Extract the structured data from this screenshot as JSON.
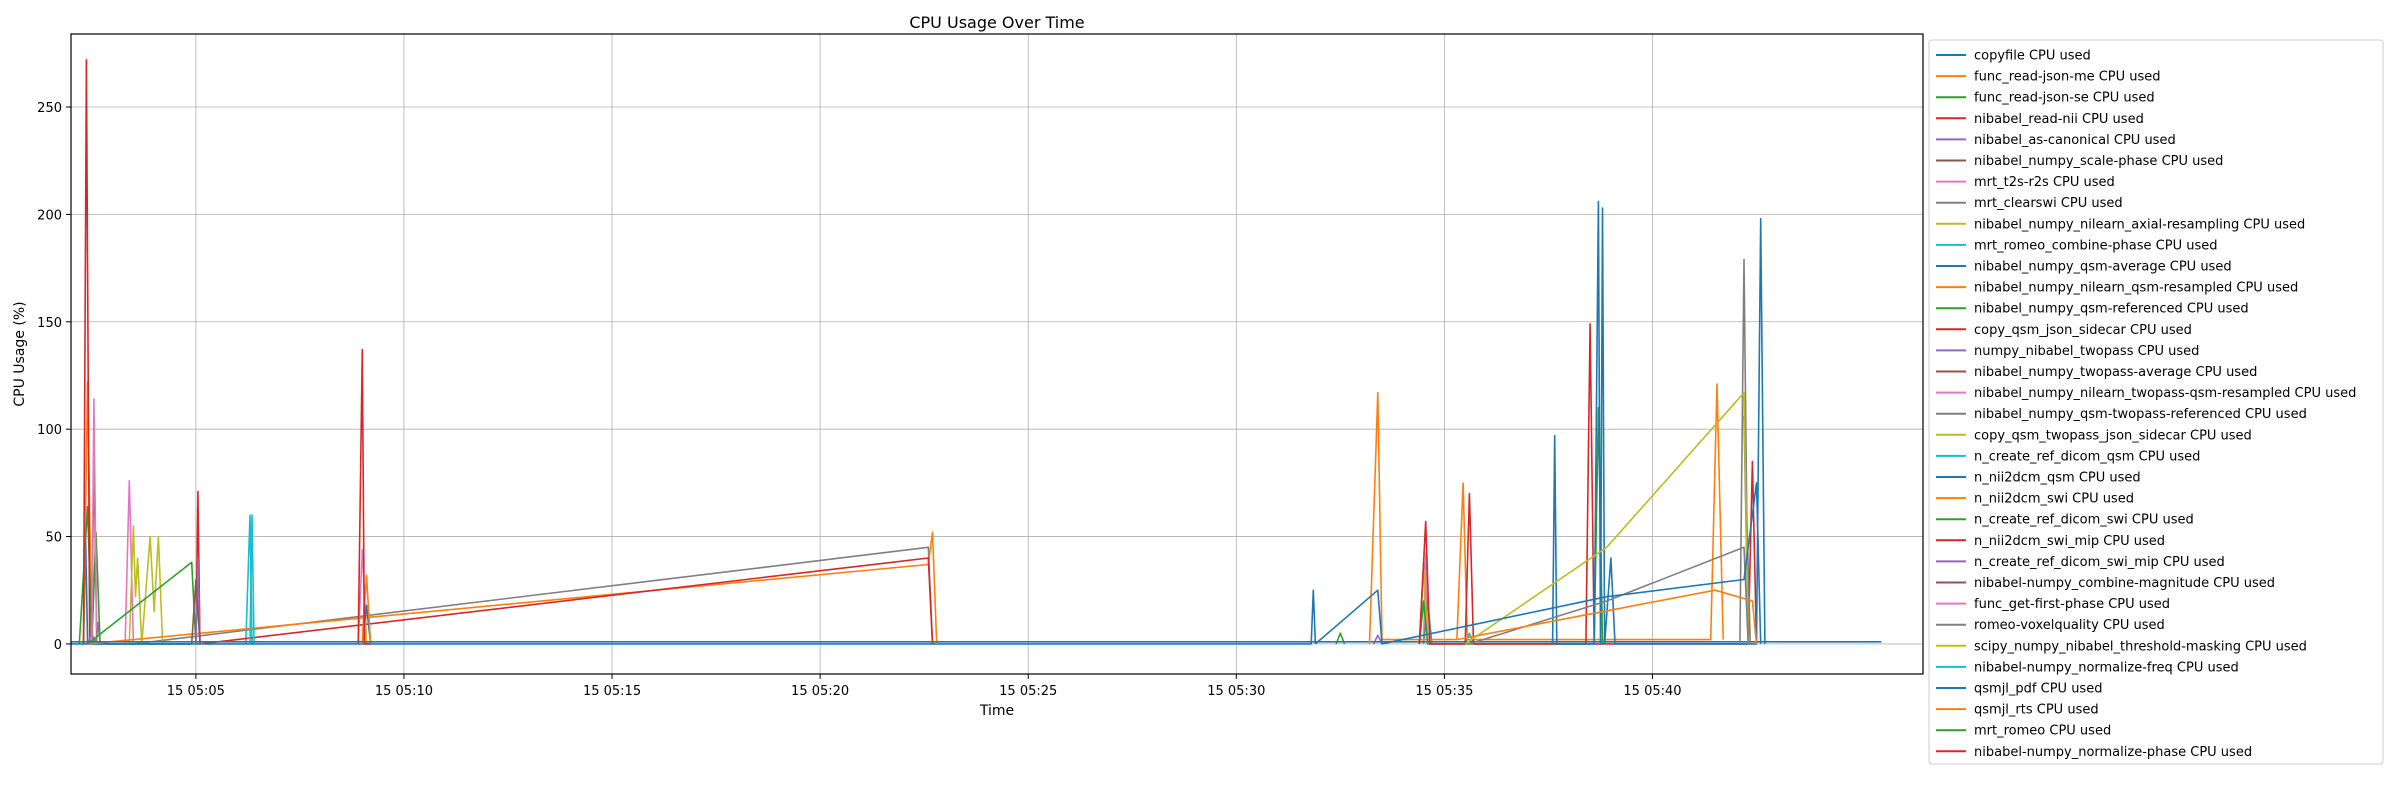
{
  "chart_data": {
    "type": "line",
    "title": "CPU Usage Over Time",
    "xlabel": "Time",
    "ylabel": "CPU Usage (%)",
    "x_ticks": [
      "15 05:05",
      "15 05:10",
      "15 05:15",
      "15 05:20",
      "15 05:25",
      "15 05:30",
      "15 05:35",
      "15 05:40"
    ],
    "x_tick_values_min": [
      65,
      70,
      75,
      80,
      85,
      90,
      95,
      100
    ],
    "xlim_min": [
      62.0,
      106.5
    ],
    "y_ticks": [
      0,
      50,
      100,
      150,
      200,
      250
    ],
    "ylim": [
      -14,
      284
    ],
    "grid": true,
    "legend_position": "outside right",
    "colors": [
      "#1f77b4",
      "#ff7f0e",
      "#2ca02c",
      "#d62728",
      "#9467bd",
      "#8c564b",
      "#e377c2",
      "#7f7f7f",
      "#bcbd22",
      "#17becf"
    ],
    "series": [
      {
        "name": "copyfile CPU used",
        "points": [
          [
            62.3,
            0
          ],
          [
            62.35,
            50
          ],
          [
            62.4,
            0
          ],
          [
            64.9,
            0
          ]
        ]
      },
      {
        "name": "func_read-json-me CPU used",
        "points": [
          [
            62.3,
            0
          ],
          [
            62.4,
            122
          ],
          [
            62.5,
            0
          ],
          [
            62.9,
            0
          ]
        ]
      },
      {
        "name": "func_read-json-se CPU used",
        "points": [
          [
            62.2,
            0
          ],
          [
            62.4,
            64
          ],
          [
            62.5,
            0
          ],
          [
            62.6,
            52
          ],
          [
            62.7,
            0
          ],
          [
            64.9,
            0
          ]
        ]
      },
      {
        "name": "nibabel_read-nii CPU used",
        "points": [
          [
            62.3,
            0
          ],
          [
            62.37,
            272
          ],
          [
            62.45,
            0
          ],
          [
            62.6,
            2
          ]
        ]
      },
      {
        "name": "nibabel_as-canonical CPU used",
        "points": [
          [
            62.4,
            0
          ],
          [
            62.5,
            5
          ],
          [
            62.6,
            0
          ]
        ]
      },
      {
        "name": "nibabel_numpy_scale-phase CPU used",
        "points": [
          [
            62.5,
            0
          ],
          [
            62.55,
            90
          ],
          [
            62.62,
            0
          ],
          [
            62.7,
            0
          ]
        ]
      },
      {
        "name": "mrt_t2s-r2s CPU used",
        "points": [
          [
            62.5,
            0
          ],
          [
            62.55,
            114
          ],
          [
            62.62,
            0
          ],
          [
            63.3,
            0
          ],
          [
            63.4,
            76
          ],
          [
            63.5,
            0
          ]
        ]
      },
      {
        "name": "mrt_clearswi CPU used",
        "points": [
          [
            62.6,
            0
          ],
          [
            62.65,
            10
          ],
          [
            62.7,
            0
          ],
          [
            63.5,
            0
          ],
          [
            82.6,
            45
          ],
          [
            82.7,
            0
          ]
        ]
      },
      {
        "name": "nibabel_numpy_nilearn_axial-resampling CPU used",
        "points": [
          [
            63.4,
            0
          ],
          [
            63.5,
            55
          ],
          [
            63.55,
            22
          ],
          [
            63.6,
            40
          ],
          [
            63.7,
            0
          ],
          [
            63.9,
            50
          ],
          [
            64.0,
            15
          ],
          [
            64.1,
            50
          ],
          [
            64.2,
            0
          ]
        ]
      },
      {
        "name": "mrt_romeo_combine-phase CPU used",
        "points": [
          [
            66.2,
            0
          ],
          [
            66.3,
            60
          ],
          [
            66.35,
            0
          ],
          [
            66.4,
            0
          ]
        ]
      },
      {
        "name": "nibabel_numpy_qsm-average CPU used",
        "points": [
          [
            62.0,
            0
          ],
          [
            91.8,
            0
          ],
          [
            91.85,
            25
          ],
          [
            91.9,
            0
          ]
        ]
      },
      {
        "name": "nibabel_numpy_nilearn_qsm-resampled CPU used",
        "points": [
          [
            62.4,
            0
          ],
          [
            82.6,
            37
          ],
          [
            82.7,
            52
          ],
          [
            82.8,
            0
          ]
        ]
      },
      {
        "name": "nibabel_numpy_qsm-referenced CPU used",
        "points": [
          [
            62.4,
            0
          ],
          [
            64.9,
            38
          ],
          [
            65.0,
            0
          ],
          [
            65.1,
            0
          ]
        ]
      },
      {
        "name": "copy_qsm_json_sidecar CPU used",
        "points": [
          [
            65.0,
            0
          ],
          [
            65.05,
            71
          ],
          [
            65.1,
            0
          ],
          [
            82.6,
            40
          ],
          [
            82.7,
            0
          ]
        ]
      },
      {
        "name": "numpy_nibabel_twopass CPU used",
        "points": [
          [
            65.0,
            0
          ],
          [
            65.05,
            40
          ],
          [
            65.1,
            0
          ],
          [
            65.2,
            0
          ]
        ]
      },
      {
        "name": "nibabel_numpy_twopass-average CPU used",
        "points": [
          [
            64.9,
            0
          ],
          [
            65.0,
            30
          ],
          [
            65.1,
            0
          ]
        ]
      },
      {
        "name": "nibabel_numpy_nilearn_twopass-qsm-resampled CPU used",
        "points": [
          [
            68.9,
            0
          ],
          [
            69.0,
            44
          ],
          [
            69.1,
            0
          ]
        ]
      },
      {
        "name": "nibabel_numpy_qsm-twopass-referenced CPU used",
        "points": [
          [
            69.0,
            0
          ],
          [
            69.05,
            20
          ],
          [
            69.1,
            0
          ]
        ]
      },
      {
        "name": "copy_qsm_twopass_json_sidecar CPU used",
        "points": [
          [
            69.0,
            0
          ],
          [
            69.05,
            18
          ],
          [
            69.1,
            0
          ]
        ]
      },
      {
        "name": "n_create_ref_dicom_qsm CPU used",
        "points": [
          [
            66.3,
            0
          ],
          [
            66.35,
            60
          ],
          [
            66.4,
            0
          ]
        ]
      },
      {
        "name": "n_nii2dcm_qsm CPU used",
        "points": [
          [
            69.0,
            0
          ],
          [
            69.1,
            18
          ],
          [
            69.2,
            0
          ]
        ]
      },
      {
        "name": "n_nii2dcm_swi CPU used",
        "points": [
          [
            69.0,
            0
          ],
          [
            69.1,
            32
          ],
          [
            69.2,
            0
          ]
        ]
      },
      {
        "name": "n_create_ref_dicom_swi CPU used",
        "points": [
          [
            92.4,
            0
          ],
          [
            92.5,
            5
          ],
          [
            92.6,
            0
          ]
        ]
      },
      {
        "name": "n_nii2dcm_swi_mip CPU used",
        "points": [
          [
            68.9,
            0
          ],
          [
            69.0,
            137
          ],
          [
            69.05,
            0
          ],
          [
            69.2,
            0
          ]
        ]
      },
      {
        "name": "n_create_ref_dicom_swi_mip CPU used",
        "points": [
          [
            93.3,
            0
          ],
          [
            93.4,
            4
          ],
          [
            93.5,
            0
          ]
        ]
      },
      {
        "name": "nibabel-numpy_combine-magnitude CPU used",
        "points": [
          [
            94.4,
            0
          ],
          [
            94.5,
            38
          ],
          [
            94.6,
            0
          ]
        ]
      },
      {
        "name": "func_get-first-phase CPU used",
        "points": [
          [
            94.5,
            0
          ],
          [
            94.55,
            42
          ],
          [
            94.6,
            0
          ]
        ]
      },
      {
        "name": "romeo-voxelquality CPU used",
        "points": [
          [
            94.5,
            0
          ],
          [
            94.6,
            20
          ],
          [
            94.7,
            0
          ]
        ]
      },
      {
        "name": "scipy_numpy_nibabel_threshold-masking CPU used",
        "points": [
          [
            94.4,
            0
          ],
          [
            94.5,
            35
          ],
          [
            94.6,
            0
          ]
        ]
      },
      {
        "name": "nibabel-numpy_normalize-freq CPU used",
        "points": [
          [
            95.5,
            0
          ],
          [
            95.6,
            5
          ],
          [
            95.7,
            0
          ]
        ]
      },
      {
        "name": "qsmjl_pdf CPU used",
        "points": [
          [
            62.0,
            1
          ],
          [
            105.5,
            1
          ]
        ]
      },
      {
        "name": "qsmjl_rts CPU used",
        "points": [
          [
            93.2,
            0
          ],
          [
            93.4,
            117
          ],
          [
            93.5,
            2
          ],
          [
            95.3,
            2
          ],
          [
            95.45,
            75
          ],
          [
            95.55,
            2
          ],
          [
            101.4,
            2
          ],
          [
            101.55,
            121
          ],
          [
            101.7,
            2
          ]
        ]
      },
      {
        "name": "mrt_romeo CPU used",
        "points": [
          [
            94.4,
            0
          ],
          [
            94.5,
            20
          ],
          [
            94.6,
            0
          ],
          [
            98.6,
            0
          ],
          [
            98.7,
            110
          ],
          [
            98.8,
            0
          ]
        ]
      },
      {
        "name": "nibabel-numpy_normalize-phase CPU used",
        "points": [
          [
            94.4,
            0
          ],
          [
            94.55,
            57
          ],
          [
            94.65,
            0
          ],
          [
            95.5,
            0
          ],
          [
            95.6,
            70
          ],
          [
            95.7,
            0
          ],
          [
            98.4,
            0
          ],
          [
            98.5,
            149
          ],
          [
            98.6,
            0
          ],
          [
            102.3,
            0
          ],
          [
            102.4,
            85
          ],
          [
            102.5,
            0
          ]
        ]
      }
    ],
    "activity_spikes": [
      {
        "series": "qsmjl_pdf CPU used",
        "points": [
          [
            97.6,
            0
          ],
          [
            97.65,
            97
          ],
          [
            97.7,
            0
          ],
          [
            98.6,
            0
          ],
          [
            98.7,
            206
          ],
          [
            98.75,
            0
          ],
          [
            98.8,
            203
          ],
          [
            98.85,
            0
          ],
          [
            99.0,
            40
          ],
          [
            99.1,
            0
          ],
          [
            102.5,
            0
          ],
          [
            102.6,
            198
          ],
          [
            102.7,
            0
          ]
        ]
      },
      {
        "series": "nibabel_numpy_qsm-twopass-referenced CPU used",
        "points": [
          [
            102.1,
            0
          ],
          [
            102.2,
            179
          ],
          [
            102.3,
            0
          ],
          [
            102.2,
            106
          ],
          [
            102.35,
            0
          ]
        ]
      },
      {
        "series": "copy_qsm_twopass_json_sidecar CPU used",
        "points": [
          [
            95.5,
            0
          ],
          [
            98.9,
            45
          ],
          [
            102.2,
            117
          ],
          [
            102.3,
            0
          ]
        ]
      },
      {
        "series": "mrt_clearswi CPU used",
        "points": [
          [
            95.6,
            0
          ],
          [
            98.9,
            20
          ],
          [
            102.2,
            45
          ],
          [
            102.3,
            0
          ]
        ]
      },
      {
        "series": "nibabel_numpy_qsm-average CPU used",
        "points": [
          [
            91.9,
            0
          ],
          [
            93.4,
            25
          ],
          [
            93.5,
            0
          ],
          [
            98.9,
            22
          ],
          [
            102.2,
            30
          ],
          [
            102.5,
            75
          ],
          [
            102.6,
            0
          ]
        ]
      },
      {
        "series": "nibabel_numpy_nilearn_qsm-resampled CPU used",
        "points": [
          [
            95.3,
            2
          ],
          [
            98.8,
            15
          ],
          [
            101.5,
            25
          ],
          [
            102.4,
            20
          ],
          [
            102.5,
            0
          ]
        ]
      }
    ]
  }
}
